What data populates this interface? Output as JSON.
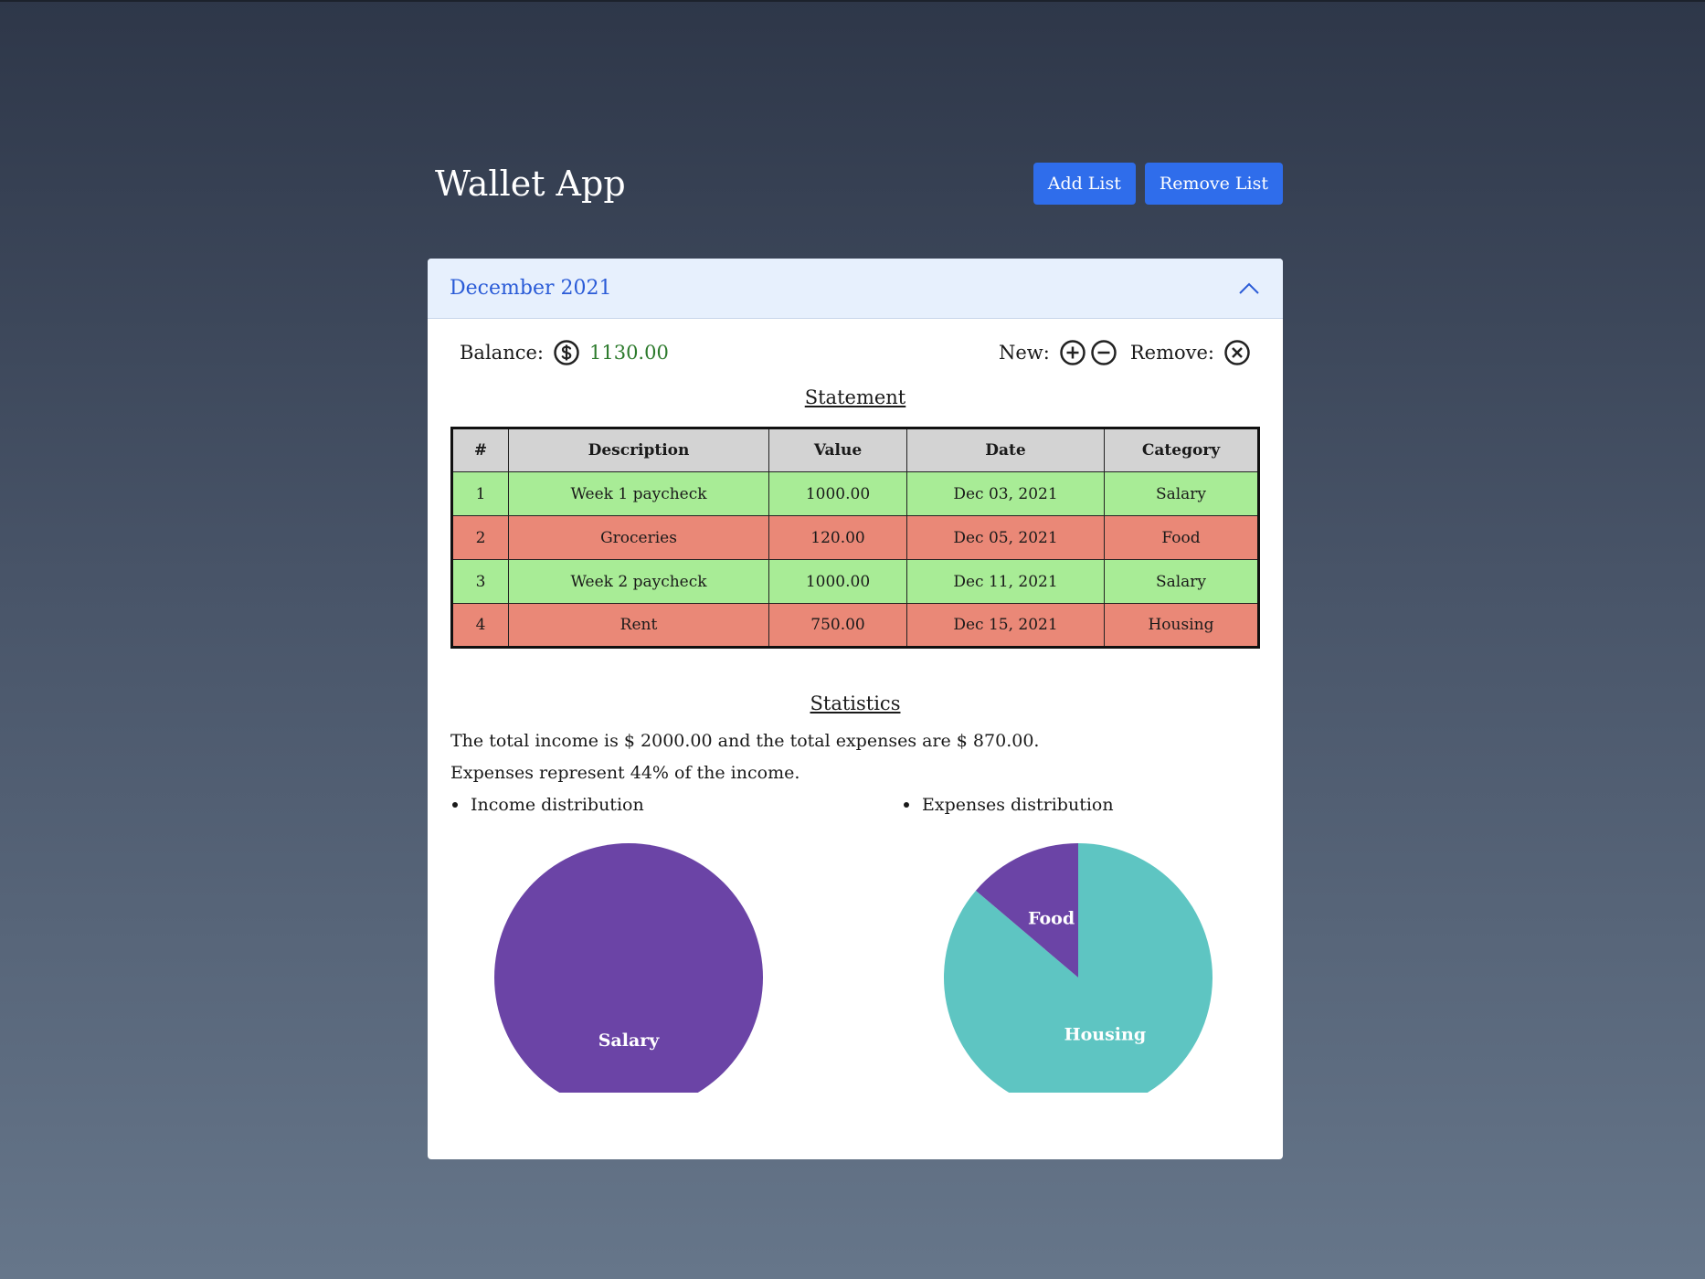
{
  "app": {
    "title": "Wallet App",
    "add_list_label": "Add List",
    "remove_list_label": "Remove List"
  },
  "list": {
    "title": "December 2021",
    "balance_label": "Balance:",
    "balance_value": "1130.00",
    "new_label": "New:",
    "remove_label": "Remove:"
  },
  "statement": {
    "title": "Statement",
    "columns": [
      "#",
      "Description",
      "Value",
      "Date",
      "Category"
    ],
    "rows": [
      {
        "n": "1",
        "description": "Week 1 paycheck",
        "value": "1000.00",
        "date": "Dec 03, 2021",
        "category": "Salary",
        "type": "income"
      },
      {
        "n": "2",
        "description": "Groceries",
        "value": "120.00",
        "date": "Dec 05, 2021",
        "category": "Food",
        "type": "expense"
      },
      {
        "n": "3",
        "description": "Week 2 paycheck",
        "value": "1000.00",
        "date": "Dec 11, 2021",
        "category": "Salary",
        "type": "income"
      },
      {
        "n": "4",
        "description": "Rent",
        "value": "750.00",
        "date": "Dec 15, 2021",
        "category": "Housing",
        "type": "expense"
      }
    ]
  },
  "statistics": {
    "title": "Statistics",
    "line1": "The total income is $ 2000.00 and the total expenses are $ 870.00.",
    "line2": "Expenses represent 44% of the income.",
    "income_label": "Income distribution",
    "expenses_label": "Expenses distribution"
  },
  "colors": {
    "income_row": "#a8ec96",
    "expense_row": "#ea8877",
    "slice_purple": "#6b44a6",
    "slice_teal": "#5ec5c2",
    "accent": "#2f6deb"
  },
  "chart_data": [
    {
      "type": "pie",
      "title": "Income distribution",
      "categories": [
        "Salary"
      ],
      "values": [
        2000
      ]
    },
    {
      "type": "pie",
      "title": "Expenses distribution",
      "categories": [
        "Food",
        "Housing"
      ],
      "values": [
        120,
        750
      ]
    }
  ]
}
